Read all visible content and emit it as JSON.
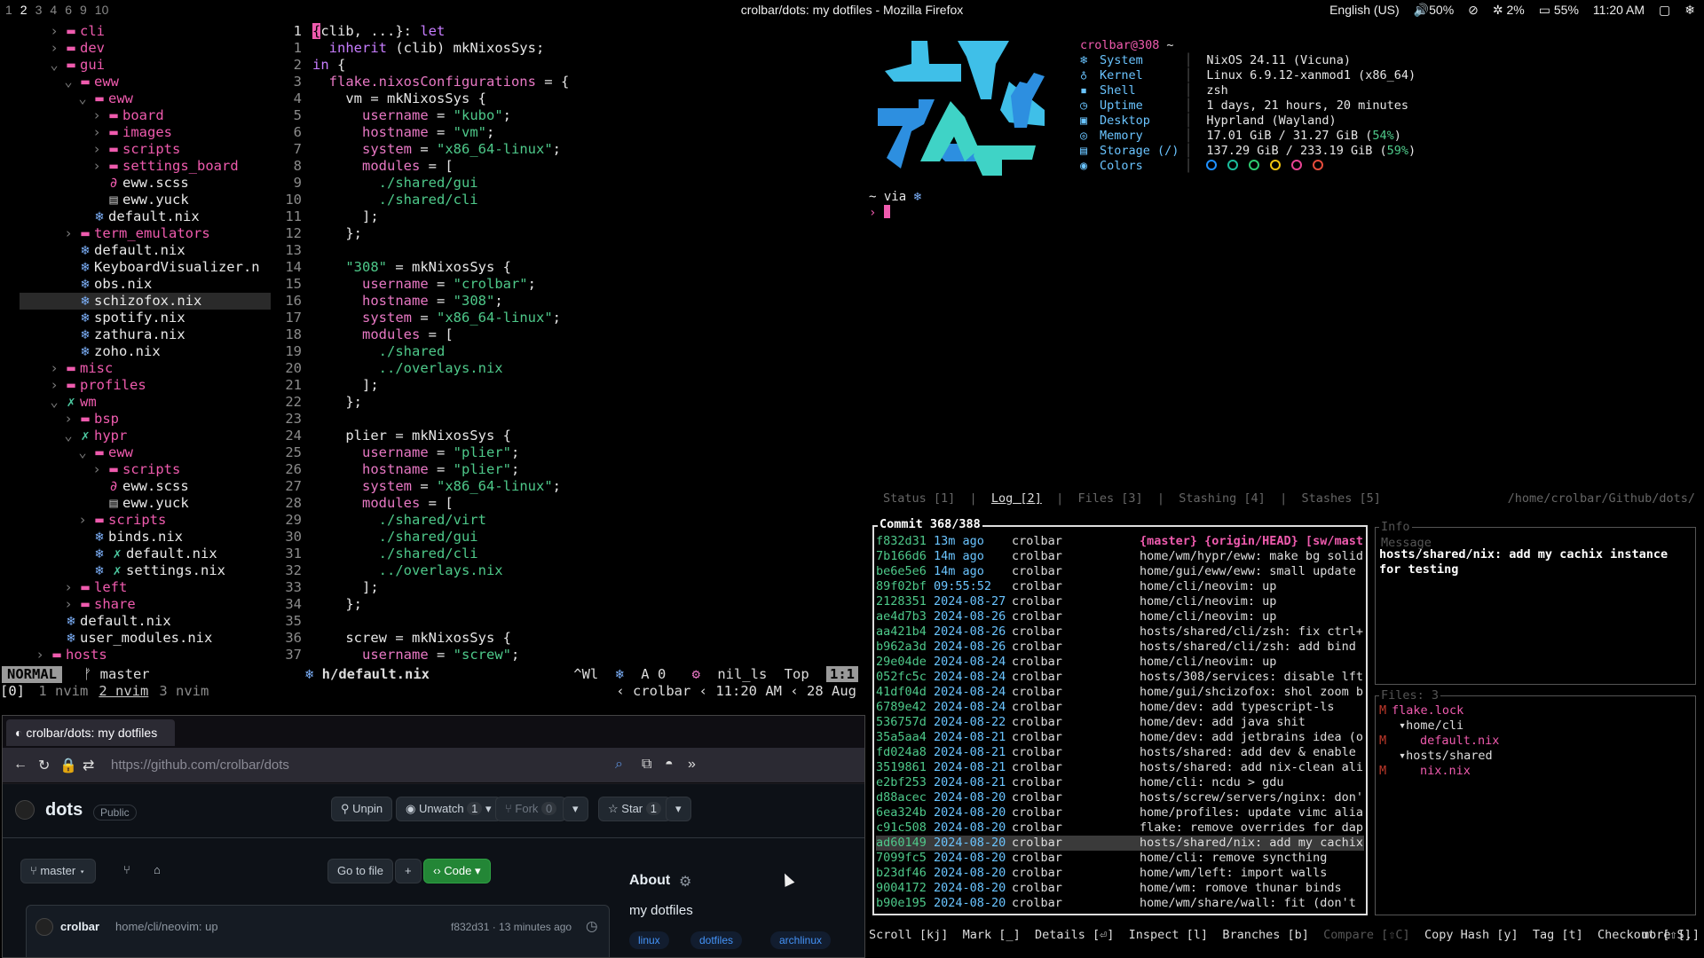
{
  "topbar": {
    "workspaces": [
      "1",
      "2",
      "3",
      "4",
      "6",
      "9",
      "10"
    ],
    "active_workspace": "2",
    "window_title": "crolbar/dots: my dotfiles - Mozilla Firefox",
    "layout": "English (US)",
    "volume": "50%",
    "cpu": "2%",
    "battery": "55%",
    "time": "11:20 AM"
  },
  "nvim": {
    "tree": [
      {
        "indent": 2,
        "chev": "›",
        "icon": "folder",
        "name": "cli"
      },
      {
        "indent": 2,
        "chev": "›",
        "icon": "folder",
        "name": "dev"
      },
      {
        "indent": 2,
        "chev": "⌄",
        "icon": "folder-open",
        "name": "gui"
      },
      {
        "indent": 3,
        "chev": "⌄",
        "icon": "folder-open",
        "name": "eww"
      },
      {
        "indent": 4,
        "chev": "⌄",
        "icon": "folder-open",
        "name": "eww"
      },
      {
        "indent": 5,
        "chev": "›",
        "icon": "folder",
        "name": "board"
      },
      {
        "indent": 5,
        "chev": "›",
        "icon": "folder",
        "name": "images"
      },
      {
        "indent": 5,
        "chev": "›",
        "icon": "folder",
        "name": "scripts"
      },
      {
        "indent": 5,
        "chev": "›",
        "icon": "folder",
        "name": "settings_board"
      },
      {
        "indent": 5,
        "chev": "",
        "icon": "scss",
        "name": "eww.scss"
      },
      {
        "indent": 5,
        "chev": "",
        "icon": "doc",
        "name": "eww.yuck"
      },
      {
        "indent": 4,
        "chev": "",
        "icon": "nix",
        "name": "default.nix"
      },
      {
        "indent": 3,
        "chev": "›",
        "icon": "folder",
        "name": "term_emulators"
      },
      {
        "indent": 3,
        "chev": "",
        "icon": "nix",
        "name": "default.nix"
      },
      {
        "indent": 3,
        "chev": "",
        "icon": "nix",
        "name": "KeyboardVisualizer.n"
      },
      {
        "indent": 3,
        "chev": "",
        "icon": "nix",
        "name": "obs.nix"
      },
      {
        "indent": 3,
        "chev": "",
        "icon": "nix",
        "name": "schizofox.nix",
        "selected": true
      },
      {
        "indent": 3,
        "chev": "",
        "icon": "nix",
        "name": "spotify.nix"
      },
      {
        "indent": 3,
        "chev": "",
        "icon": "nix",
        "name": "zathura.nix"
      },
      {
        "indent": 3,
        "chev": "",
        "icon": "nix",
        "name": "zoho.nix"
      },
      {
        "indent": 2,
        "chev": "›",
        "icon": "folder",
        "name": "misc"
      },
      {
        "indent": 2,
        "chev": "›",
        "icon": "folder",
        "name": "profiles"
      },
      {
        "indent": 2,
        "chev": "⌄",
        "icon": "git",
        "name": "wm"
      },
      {
        "indent": 3,
        "chev": "›",
        "icon": "folder",
        "name": "bsp"
      },
      {
        "indent": 3,
        "chev": "⌄",
        "icon": "git",
        "name": "hypr"
      },
      {
        "indent": 4,
        "chev": "⌄",
        "icon": "folder-open",
        "name": "eww"
      },
      {
        "indent": 5,
        "chev": "›",
        "icon": "folder",
        "name": "scripts"
      },
      {
        "indent": 5,
        "chev": "",
        "icon": "scss",
        "name": "eww.scss"
      },
      {
        "indent": 5,
        "chev": "",
        "icon": "doc",
        "name": "eww.yuck"
      },
      {
        "indent": 4,
        "chev": "›",
        "icon": "folder",
        "name": "scripts"
      },
      {
        "indent": 4,
        "chev": "",
        "icon": "nix",
        "name": "binds.nix"
      },
      {
        "indent": 4,
        "chev": "",
        "icon": "nixgit",
        "name": "default.nix"
      },
      {
        "indent": 4,
        "chev": "",
        "icon": "nixgit",
        "name": "settings.nix"
      },
      {
        "indent": 3,
        "chev": "›",
        "icon": "folder",
        "name": "left"
      },
      {
        "indent": 3,
        "chev": "›",
        "icon": "folder",
        "name": "share"
      },
      {
        "indent": 2,
        "chev": "",
        "icon": "nix",
        "name": "default.nix"
      },
      {
        "indent": 2,
        "chev": "",
        "icon": "nix",
        "name": "user_modules.nix"
      },
      {
        "indent": 1,
        "chev": "›",
        "icon": "folder",
        "name": "hosts"
      }
    ],
    "line_numbers": [
      "1",
      "1",
      "2",
      "3",
      "4",
      "5",
      "6",
      "7",
      "8",
      "9",
      "10",
      "11",
      "12",
      "13",
      "14",
      "15",
      "16",
      "17",
      "18",
      "19",
      "20",
      "21",
      "22",
      "23",
      "24",
      "25",
      "26",
      "27",
      "28",
      "29",
      "30",
      "31",
      "32",
      "33",
      "34",
      "35",
      "36",
      "37"
    ],
    "code": [
      "{clib, ...}: let",
      "  inherit (clib) mkNixosSys;",
      "in {",
      "  flake.nixosConfigurations = {",
      "    vm = mkNixosSys {",
      "      username = \"kubo\";",
      "      hostname = \"vm\";",
      "      system = \"x86_64-linux\";",
      "      modules = [",
      "        ./shared/gui",
      "        ./shared/cli",
      "      ];",
      "    };",
      "",
      "    \"308\" = mkNixosSys {",
      "      username = \"crolbar\";",
      "      hostname = \"308\";",
      "      system = \"x86_64-linux\";",
      "      modules = [",
      "        ./shared",
      "        ../overlays.nix",
      "      ];",
      "    };",
      "",
      "    plier = mkNixosSys {",
      "      username = \"plier\";",
      "      hostname = \"plier\";",
      "      system = \"x86_64-linux\";",
      "      modules = [",
      "        ./shared/virt",
      "        ./shared/gui",
      "        ./shared/cli",
      "        ../overlays.nix",
      "      ];",
      "    };",
      "",
      "    screw = mkNixosSys {",
      "      username = \"screw\";"
    ],
    "status": {
      "mode": "NORMAL",
      "branch": "master",
      "file": "h/default.nix",
      "wl": "^Wl",
      "diag": "A 0",
      "lsp": "nil_ls",
      "scroll": "Top",
      "pos": "1:1"
    },
    "tmux": {
      "session": "[0]",
      "windows": [
        "1 nvim",
        "2 nvim",
        "3 nvim"
      ],
      "active": 1,
      "user": "crolbar",
      "time": "11:20 AM",
      "date": "28 Aug"
    }
  },
  "firefox": {
    "tab_title": "crolbar/dots: my dotfiles",
    "url": "https://github.com/crolbar/dots",
    "repo_name": "dots",
    "visibility": "Public",
    "unpin": "Unpin",
    "unwatch": "Unwatch",
    "unwatch_count": "1",
    "fork": "Fork",
    "fork_count": "0",
    "star": "Star",
    "star_count": "1",
    "branch": "master",
    "go_to_file": "Go to file",
    "code_btn": "Code",
    "about": "About",
    "description": "my dotfiles",
    "topics": [
      "linux",
      "dotfiles",
      "archlinux"
    ],
    "commit_author": "crolbar",
    "commit_msg": "home/cli/neovim: up",
    "commit_meta": "f832d31 · 13 minutes ago"
  },
  "fastfetch": {
    "header_user": "crolbar",
    "header_host": "@308",
    "header_path": "~",
    "rows": [
      {
        "icon": "❄",
        "key": "System",
        "value": "NixOS 24.11 (Vicuna)"
      },
      {
        "icon": "♁",
        "key": "Kernel",
        "value": "Linux 6.9.12-xanmod1 (x86_64)"
      },
      {
        "icon": "▪",
        "key": "Shell",
        "value": "zsh"
      },
      {
        "icon": "◷",
        "key": "Uptime",
        "value": "1 days, 21 hours, 20 minutes"
      },
      {
        "icon": "▣",
        "key": "Desktop",
        "value": "Hyprland (Wayland)"
      },
      {
        "icon": "◎",
        "key": "Memory",
        "value": "17.01 GiB / 31.27 GiB",
        "pct": "54%"
      },
      {
        "icon": "▤",
        "key": "Storage (/)",
        "value": "137.29 GiB / 233.19 GiB",
        "pct": "59%"
      },
      {
        "icon": "◉",
        "key": "Colors",
        "value": ""
      }
    ],
    "color_dots": [
      "#1e90ff",
      "#1abc9c",
      "#2ecc71",
      "#f1c40f",
      "#e84393",
      "#e74c3c"
    ],
    "prompt_line": "~ via ",
    "prompt_char": "›"
  },
  "lazygit": {
    "tabs": [
      "Status [1]",
      "Log [2]",
      "Files [3]",
      "Stashing [4]",
      "Stashes [5]"
    ],
    "active_tab": 1,
    "path": "/home/crolbar/Github/dots/",
    "commit_title": "Commit 368/388",
    "commits": [
      {
        "hash": "f832d31",
        "date": "13m ago",
        "author": "crolbar",
        "ref": "{master} {origin/HEAD} [sw/mast",
        "msg": ""
      },
      {
        "hash": "7b166d6",
        "date": "14m ago",
        "author": "crolbar",
        "msg": "home/wm/hypr/eww: make bg solid"
      },
      {
        "hash": "be6e5e6",
        "date": "14m ago",
        "author": "crolbar",
        "msg": "home/gui/eww/eww: small update"
      },
      {
        "hash": "89f02bf",
        "date": "09:55:52",
        "author": "crolbar",
        "msg": "home/cli/neovim: up"
      },
      {
        "hash": "2128351",
        "date": "2024-08-27",
        "author": "crolbar",
        "msg": "home/cli/neovim: up"
      },
      {
        "hash": "ae4d7b3",
        "date": "2024-08-26",
        "author": "crolbar",
        "msg": "home/cli/neovim: up"
      },
      {
        "hash": "aa421b4",
        "date": "2024-08-26",
        "author": "crolbar",
        "msg": "hosts/shared/cli/zsh: fix ctrl+"
      },
      {
        "hash": "b962a3d",
        "date": "2024-08-26",
        "author": "crolbar",
        "msg": "hosts/shared/cli/zsh: add bind"
      },
      {
        "hash": "29e04de",
        "date": "2024-08-24",
        "author": "crolbar",
        "msg": "home/cli/neovim: up"
      },
      {
        "hash": "052fc5c",
        "date": "2024-08-24",
        "author": "crolbar",
        "msg": "hosts/308/services: disable lft"
      },
      {
        "hash": "41df04d",
        "date": "2024-08-24",
        "author": "crolbar",
        "msg": "home/gui/shcizofox: shol zoom b"
      },
      {
        "hash": "6789e42",
        "date": "2024-08-24",
        "author": "crolbar",
        "msg": "home/dev: add typescript-ls"
      },
      {
        "hash": "536757d",
        "date": "2024-08-22",
        "author": "crolbar",
        "msg": "home/dev: add java shit"
      },
      {
        "hash": "35a5aa4",
        "date": "2024-08-21",
        "author": "crolbar",
        "msg": "home/dev: add jetbrains idea (o"
      },
      {
        "hash": "fd024a8",
        "date": "2024-08-21",
        "author": "crolbar",
        "msg": "hosts/shared: add dev & enable"
      },
      {
        "hash": "3519861",
        "date": "2024-08-21",
        "author": "crolbar",
        "msg": "hosts/shared: add nix-clean ali"
      },
      {
        "hash": "e2bf253",
        "date": "2024-08-21",
        "author": "crolbar",
        "msg": "home/cli: ncdu > gdu"
      },
      {
        "hash": "d88acec",
        "date": "2024-08-20",
        "author": "crolbar",
        "msg": "hosts/screw/servers/nginx: don'"
      },
      {
        "hash": "6ea324b",
        "date": "2024-08-20",
        "author": "crolbar",
        "msg": "home/profiles: update vimc alia"
      },
      {
        "hash": "c91c508",
        "date": "2024-08-20",
        "author": "crolbar",
        "msg": "flake: remove overrides for dap"
      },
      {
        "hash": "ad60149",
        "date": "2024-08-20",
        "author": "crolbar",
        "msg": "hosts/shared/nix: add my cachix",
        "selected": true
      },
      {
        "hash": "7099fc5",
        "date": "2024-08-20",
        "author": "crolbar",
        "msg": "home/cli: remove syncthing"
      },
      {
        "hash": "b23df46",
        "date": "2024-08-20",
        "author": "crolbar",
        "msg": "home/wm/left: import walls"
      },
      {
        "hash": "9004172",
        "date": "2024-08-20",
        "author": "crolbar",
        "msg": "home/wm: romove thunar binds"
      },
      {
        "hash": "b90e195",
        "date": "2024-08-20",
        "author": "crolbar",
        "msg": "home/wm/share/wall: fit (don't"
      }
    ],
    "info_title": "Info",
    "message_title": "Message",
    "message": "hosts/shared/nix: add my cachix instance for testing",
    "files_title": "Files: 3",
    "files": [
      {
        "s": "M",
        "name": "flake.lock",
        "type": "file",
        "indent": 0
      },
      {
        "s": "",
        "name": "▾home/cli",
        "type": "dir",
        "indent": 1
      },
      {
        "s": "M",
        "name": "default.nix",
        "type": "file",
        "indent": 4
      },
      {
        "s": "",
        "name": "▾hosts/shared",
        "type": "dir",
        "indent": 1
      },
      {
        "s": "M",
        "name": "nix.nix",
        "type": "file",
        "indent": 4
      }
    ],
    "footer": [
      "Scroll [kj]",
      "Mark [_]",
      "Details [⏎]",
      "Inspect [l]",
      "Branches [b]"
    ],
    "footer_dim": "Compare [⇧C]",
    "footer2": [
      "Copy Hash [y]",
      "Tag [t]",
      "Checkout [⇧S]"
    ],
    "footer_more": "more [.]"
  }
}
